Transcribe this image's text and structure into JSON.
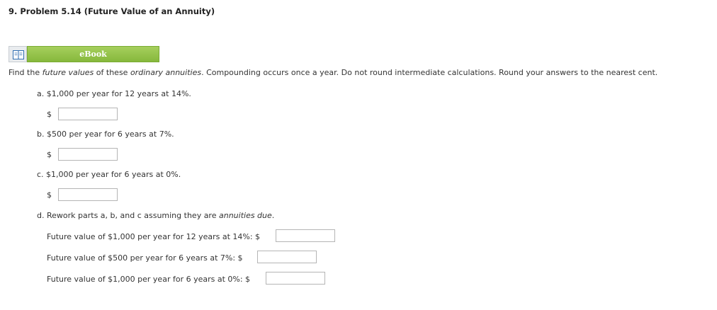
{
  "problem": {
    "title": "9. Problem 5.14 (Future Value of an Annuity)"
  },
  "ebook": {
    "icon": "book-icon",
    "label": "eBook"
  },
  "instructions": {
    "before_fv": "Find the ",
    "future_values": "future values",
    "of_these": " of these ",
    "ordinary_annuities": "ordinary annuities",
    "rest": ". Compounding occurs once a year. Do not round intermediate calculations. Round your answers to the nearest cent."
  },
  "parts": {
    "a": {
      "text": "a. $1,000 per year for 12 years at 14%.",
      "currency": "$",
      "value": ""
    },
    "b": {
      "text": "b. $500 per year for 6 years at 7%.",
      "currency": "$",
      "value": ""
    },
    "c": {
      "text": "c. $1,000 per year for 6 years at 0%.",
      "currency": "$",
      "value": ""
    },
    "d": {
      "prefix": "d. Rework parts a, b, and c assuming they are ",
      "annuities_due": "annuities due",
      "suffix": ".",
      "lines": [
        {
          "label": "Future value of $1,000 per year for 12 years at 14%: $",
          "value": ""
        },
        {
          "label": "Future value of $500 per year for 6 years at 7%: $",
          "value": ""
        },
        {
          "label": "Future value of $1,000 per year for 6 years at 0%: $",
          "value": ""
        }
      ]
    }
  }
}
